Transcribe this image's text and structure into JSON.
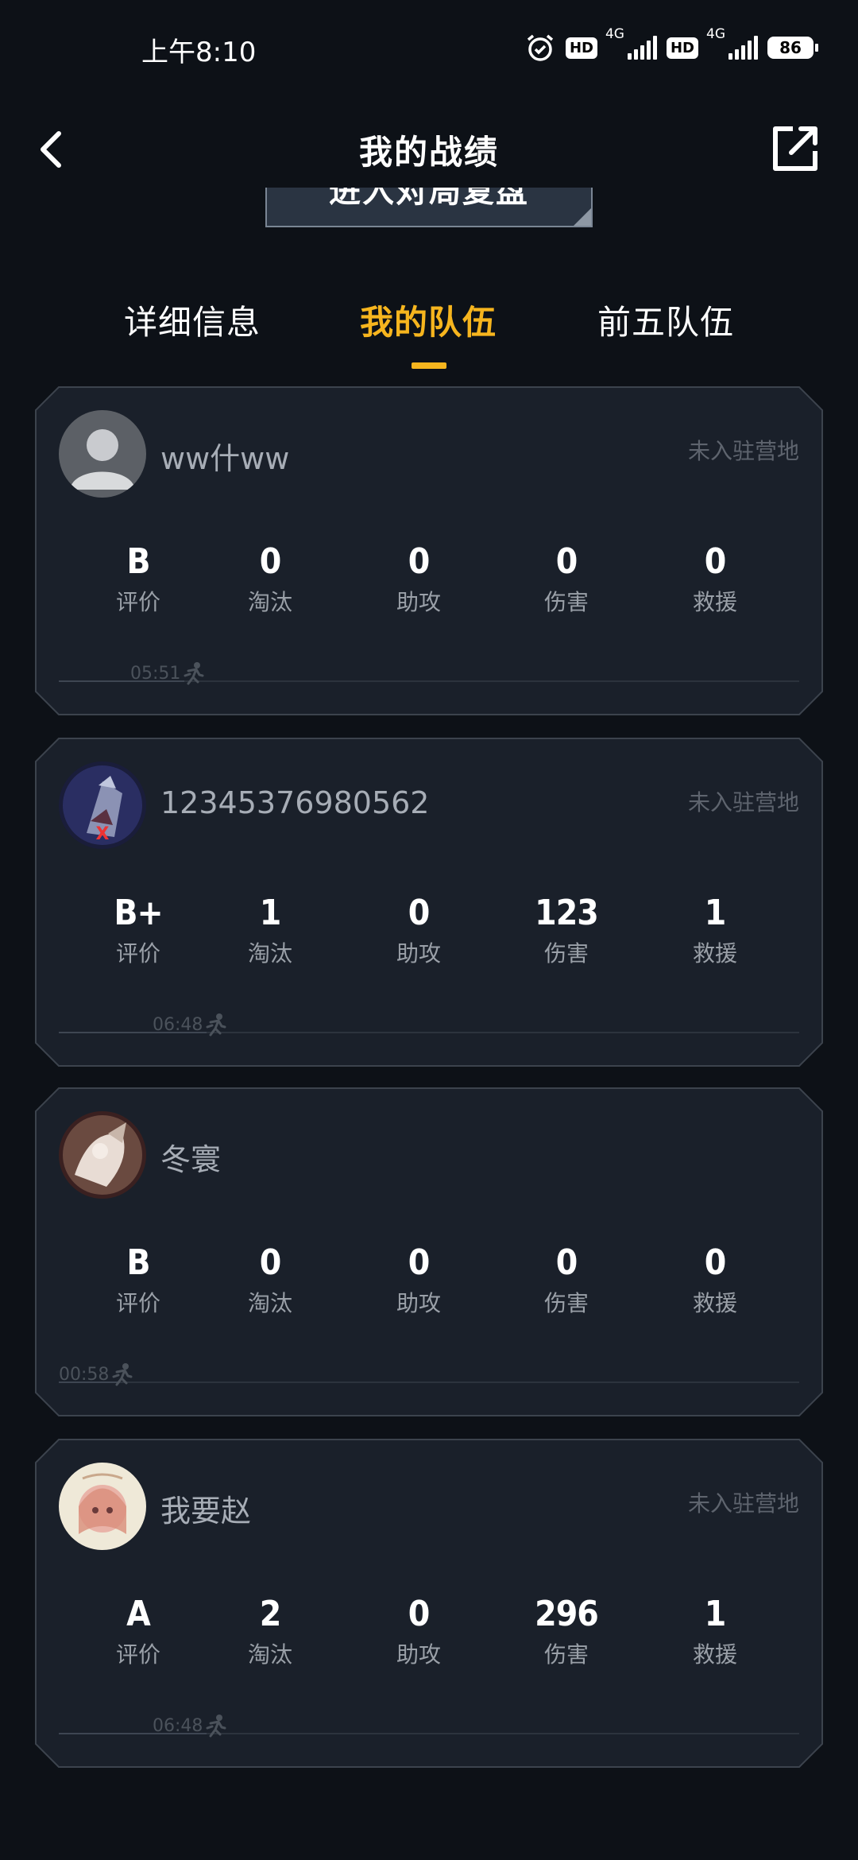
{
  "status_bar": {
    "time": "上午8:10",
    "hd1": "HD",
    "net1": "4G",
    "hd2": "HD",
    "net2": "4G",
    "battery": "86"
  },
  "header": {
    "title": "我的战绩",
    "back_icon": "chevron-left-icon",
    "share_icon": "share-external-icon"
  },
  "replay_banner": {
    "label": "进入对局复盘"
  },
  "tabs": [
    {
      "label": "详细信息",
      "active": false
    },
    {
      "label": "我的队伍",
      "active": true
    },
    {
      "label": "前五队伍",
      "active": false
    }
  ],
  "stat_labels": [
    "评价",
    "淘汰",
    "助攻",
    "伤害",
    "救援"
  ],
  "players": [
    {
      "name": "ww什ww",
      "camp": "未入驻营地",
      "avatar": "default-avatar",
      "stats": [
        "B",
        "0",
        "0",
        "0",
        "0"
      ],
      "survival_time": "05:51",
      "survival_fraction": 0.17
    },
    {
      "name": "12345376980562",
      "camp": "未入驻营地",
      "avatar": "warrior-avatar",
      "stats": [
        "B+",
        "1",
        "0",
        "123",
        "1"
      ],
      "survival_time": "06:48",
      "survival_fraction": 0.2
    },
    {
      "name": "冬寰",
      "camp": "",
      "avatar": "anime-avatar",
      "stats": [
        "B",
        "0",
        "0",
        "0",
        "0"
      ],
      "survival_time": "00:58",
      "survival_fraction": 0.08
    },
    {
      "name": "我要赵",
      "camp": "未入驻营地",
      "avatar": "cartoon-girl-avatar",
      "stats": [
        "A",
        "2",
        "0",
        "296",
        "1"
      ],
      "survival_time": "06:48",
      "survival_fraction": 0.2
    }
  ],
  "colors": {
    "background": "#0d1117",
    "card_bg": "#1a202a",
    "card_border": "#3c434d",
    "accent": "#f6b51e"
  }
}
